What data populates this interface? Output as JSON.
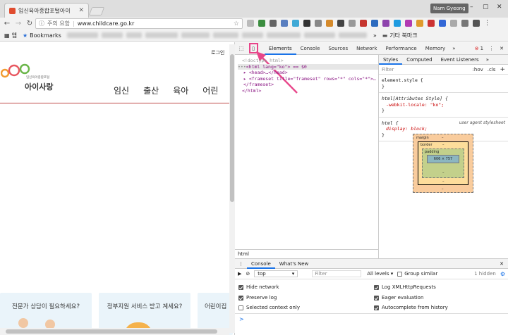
{
  "browser": {
    "tab_title": "임신육아종합포털아이",
    "profile": "Nam Gyeong",
    "url_info": "주의 요함",
    "url": "www.childcare.go.kr",
    "bookmarks_label": "Bookmarks",
    "apps_label": "앱",
    "other_bookmarks": "기타 북마크"
  },
  "site": {
    "login": "로그인",
    "logo_small": "임신육아종합포털",
    "logo_name": "아이사랑",
    "menu": [
      "임신",
      "출산",
      "육아",
      "어린"
    ],
    "cards": [
      "전문가 상담이 필요하세요?",
      "정부지원 서비스 받고 계세요?",
      "어린이집"
    ]
  },
  "devtools": {
    "tabs": [
      "Elements",
      "Console",
      "Sources",
      "Network",
      "Performance",
      "Memory"
    ],
    "error_count": "1",
    "code": {
      "doctype": "<!doctype html>",
      "html_open": "<html lang=\"ko\"> == $0",
      "head": "<head>…</head>",
      "frameset": "<frameset title=\"frameset\" rows=\"*\" cols=\"*\">…",
      "frameset_close": "</frameset>",
      "html_close": "</html>"
    },
    "breadcrumb": "html",
    "style_tabs": [
      "Styles",
      "Computed",
      "Event Listeners"
    ],
    "filter_placeholder": "Filter",
    "filter_hov": ":hov",
    "filter_cls": ".cls",
    "rules": {
      "element_style": "element.style {",
      "attr_selector": "html[Attributes Style] {",
      "attr_decl": "-webkit-locale: \"ko\";",
      "html_selector": "html {",
      "ua_label": "user agent stylesheet",
      "html_decl": "display: block;",
      "close": "}"
    },
    "box_model": {
      "margin": "margin",
      "border": "border",
      "padding": "padding",
      "content": "606 × 757",
      "dash": "–"
    },
    "console": {
      "tabs": [
        "Console",
        "What's New"
      ],
      "context": "top",
      "filter_placeholder": "Filter",
      "levels": "All levels",
      "group_similar": "Group similar",
      "hidden": "1 hidden",
      "options_left": [
        "Hide network",
        "Preserve log",
        "Selected context only"
      ],
      "options_right": [
        "Log XMLHttpRequests",
        "Eager evaluation",
        "Autocomplete from history"
      ],
      "prompt": ">"
    }
  },
  "colors": {
    "highlight": "#e8468a",
    "accent_line": "#c04b48",
    "active_tab": "#1a73e8",
    "card_bg": "#eaf4fa"
  }
}
